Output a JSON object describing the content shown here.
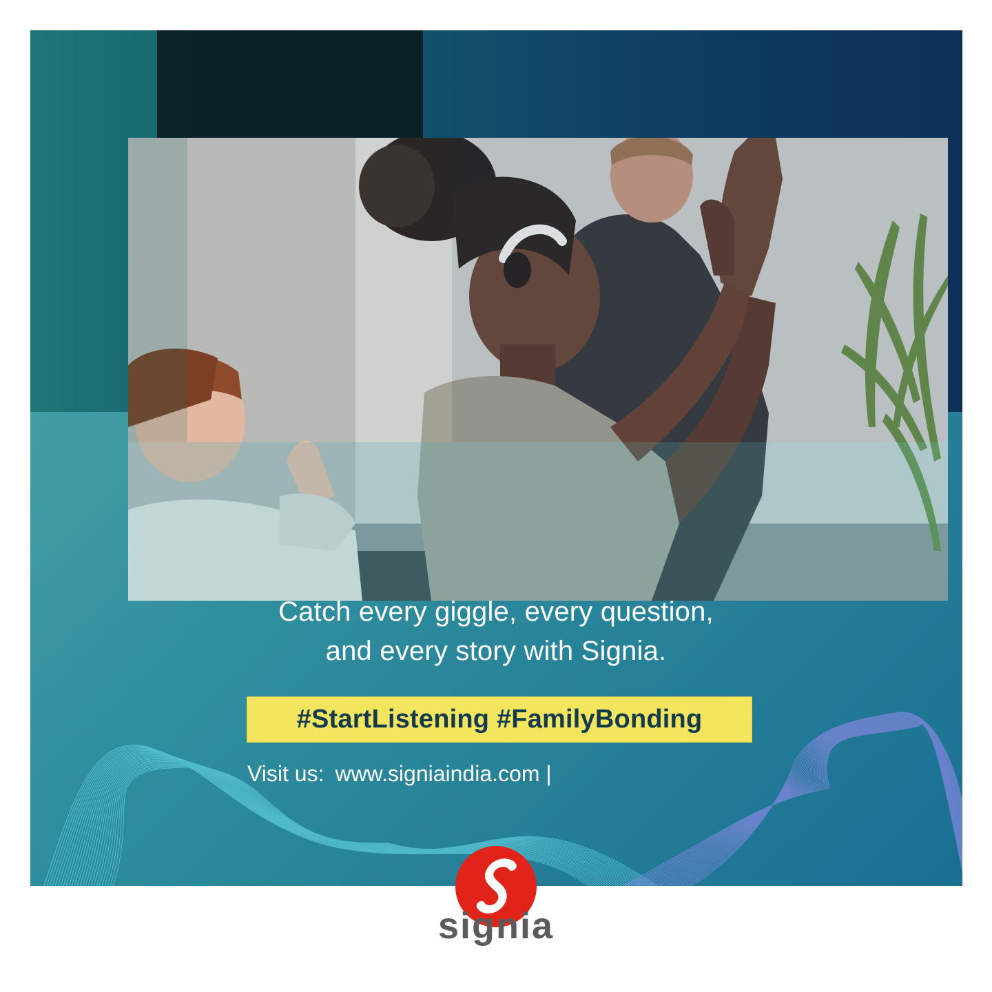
{
  "tagline": {
    "line1": "Catch every giggle, every question,",
    "line2": "and every story with Signia."
  },
  "hashtags": "#StartListening #FamilyBonding",
  "visit": {
    "label": "Visit us:",
    "url": "www.signiaindia.com |"
  },
  "brand": {
    "name": "signia",
    "logo_letter": "s",
    "colors": {
      "logo_red": "#e2231a",
      "wordmark_grey": "#5b5b5b",
      "hashtag_yellow": "#f3e55d",
      "hashtag_text": "#143a4d",
      "teal": "#2f8f9e",
      "navy": "#0f3c63"
    }
  },
  "photo": {
    "subject": "family-exercise-photo"
  }
}
